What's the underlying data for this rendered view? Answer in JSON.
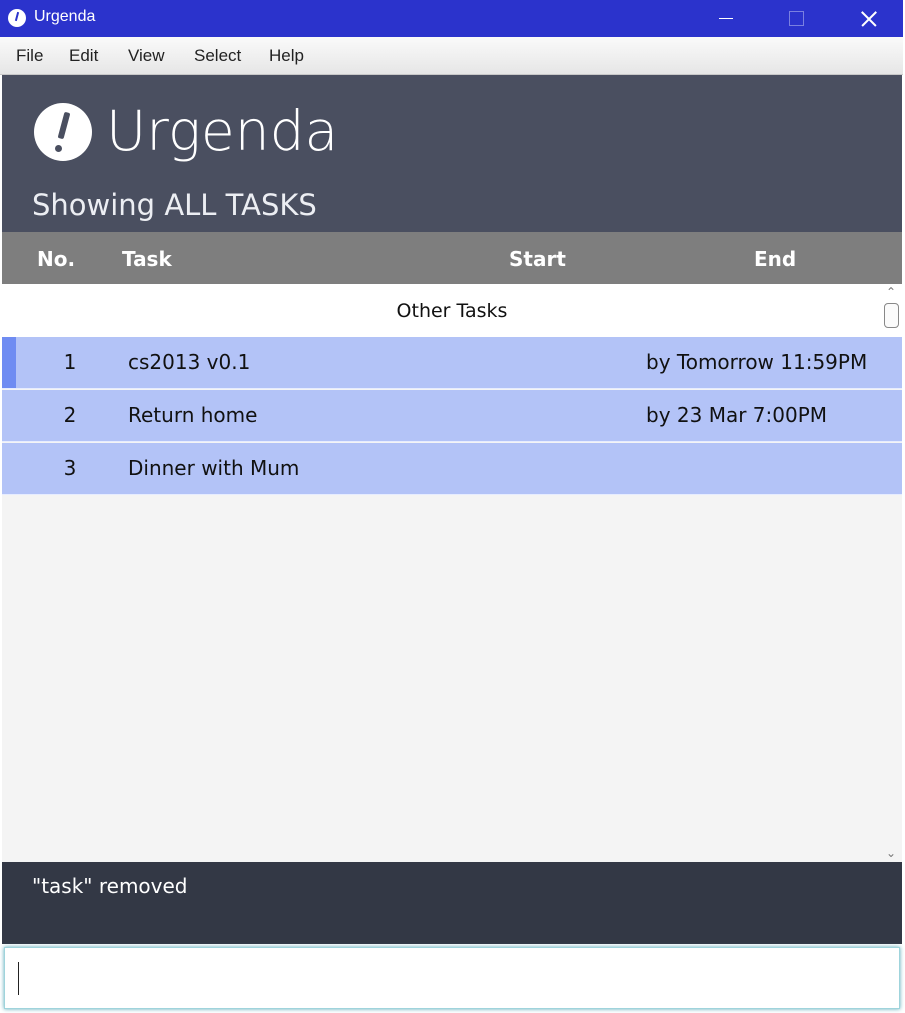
{
  "window": {
    "title": "Urgenda"
  },
  "menu": [
    "File",
    "Edit",
    "View",
    "Select",
    "Help"
  ],
  "header": {
    "logo": "Urgenda",
    "subtitle": "Showing ALL TASKS"
  },
  "columns": {
    "no": "No.",
    "task": "Task",
    "start": "Start",
    "end": "End"
  },
  "list": {
    "section_title": "Other Tasks",
    "rows": [
      {
        "no": "1",
        "task": "cs2013 v0.1",
        "end": "by  Tomorrow 11:59PM",
        "selected": true
      },
      {
        "no": "2",
        "task": "Return home",
        "end": "by  23 Mar 7:00PM"
      },
      {
        "no": "3",
        "task": "Dinner with Mum",
        "end": ""
      }
    ]
  },
  "feedback": "\"task\" removed",
  "command_input": {
    "value": ""
  },
  "colors": {
    "titlebar": "#2b33cc",
    "header": "#4a4f60",
    "row": "#b3c3f7",
    "selected": "#6f8cf2",
    "feedback": "#333845"
  }
}
